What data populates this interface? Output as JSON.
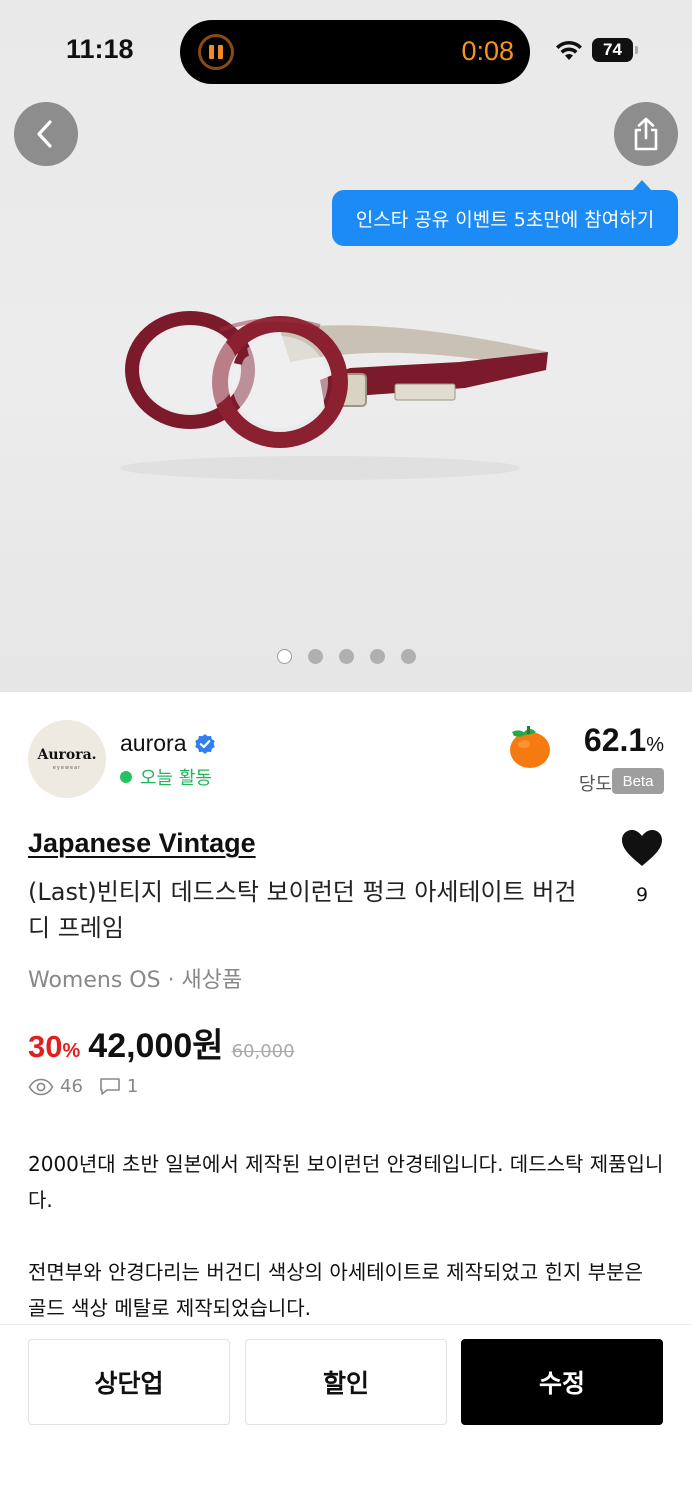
{
  "status_bar": {
    "time": "11:18",
    "timer": "0:08",
    "battery": "74"
  },
  "hero": {
    "tooltip": "인스타 공유 이벤트 5초만에 참여하기",
    "image_count": 5,
    "active_index": 0,
    "icons": [
      "back-icon",
      "share-icon",
      "pause-icon",
      "wifi-icon",
      "battery-icon"
    ]
  },
  "seller": {
    "avatar_text": "Aurora.",
    "avatar_subtext": "eyewear",
    "name": "aurora",
    "activity": "오늘 활동",
    "sweetness_value": "62.1",
    "sweetness_unit": "%",
    "sweetness_label": "당도",
    "beta": "Beta"
  },
  "product": {
    "brand": "Japanese Vintage",
    "title": "(Last)빈티지 데드스탁 보이런던 펑크 아세테이트 버건디 프레임",
    "meta": "Womens OS · 새상품",
    "likes": "9",
    "discount": "30",
    "discount_unit": "%",
    "price": "42,000원",
    "original_price": "60,000",
    "views": "46",
    "comments": "1",
    "description": [
      "2000년대 초반 일본에서 제작된 보이런던 안경테입니다. 데드스탁 제품입니다.",
      "전면부와 안경다리는 버건디 색상의 아세테이트로 제작되었고 힌지 부분은 골드 색상 메탈로 제작되었습니다."
    ]
  },
  "actions": {
    "bump": "상단업",
    "discount": "할인",
    "edit": "수정"
  },
  "colors": {
    "accent_blue": "#1c8bf5",
    "discount_red": "#e02020",
    "active_green": "#22b45a",
    "frame_burgundy": "#7a1a2a"
  }
}
